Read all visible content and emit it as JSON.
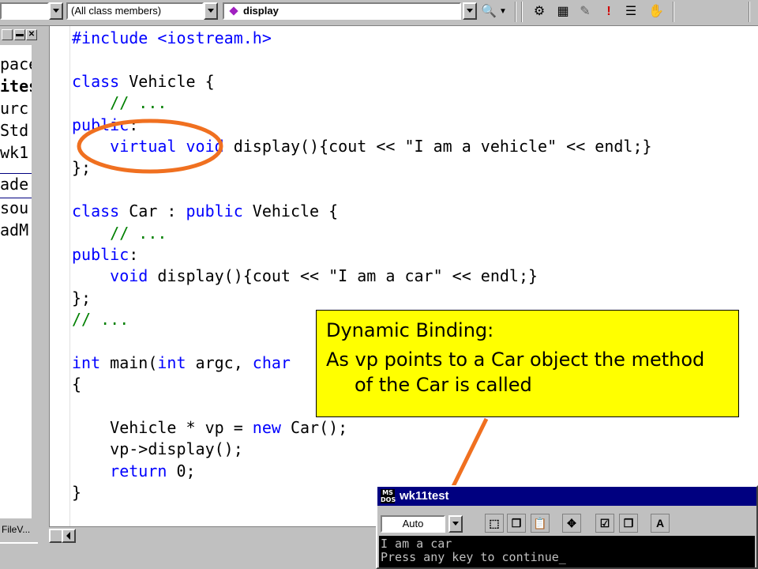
{
  "toolbar": {
    "members_filter": "(All class members)",
    "function_combo": "display",
    "icons": [
      "find-in-files-icon",
      "compile-icon",
      "build-icon",
      "stop-build-icon",
      "execute-icon",
      "output-icon",
      "hand-icon"
    ]
  },
  "workspace": {
    "items": [
      {
        "text": "pace",
        "bold": false
      },
      {
        "text": "ites",
        "bold": true
      },
      {
        "text": "urc",
        "bold": false
      },
      {
        "text": "Std",
        "bold": false
      },
      {
        "text": "wk1",
        "bold": false
      },
      {
        "text": "ade",
        "bold": false
      },
      {
        "text": "sou",
        "bold": false
      },
      {
        "text": "adM",
        "bold": false
      }
    ],
    "tab_label": "FileV..."
  },
  "editor": {
    "lines": [
      [
        {
          "t": "#include <iostream.h>",
          "c": "kw"
        }
      ],
      [
        {
          "t": "",
          "c": ""
        }
      ],
      [
        {
          "t": "class",
          "c": "kw"
        },
        {
          "t": " Vehicle {",
          "c": ""
        }
      ],
      [
        {
          "t": "    // ...",
          "c": "cm"
        }
      ],
      [
        {
          "t": "public",
          "c": "kw"
        },
        {
          "t": ":",
          "c": ""
        }
      ],
      [
        {
          "t": "    ",
          "c": ""
        },
        {
          "t": "virtual",
          "c": "kw"
        },
        {
          "t": " ",
          "c": ""
        },
        {
          "t": "void",
          "c": "kw"
        },
        {
          "t": " display(){cout << \"I am a vehicle\" << endl;}",
          "c": ""
        }
      ],
      [
        {
          "t": "};",
          "c": ""
        }
      ],
      [
        {
          "t": "",
          "c": ""
        }
      ],
      [
        {
          "t": "class",
          "c": "kw"
        },
        {
          "t": " Car : ",
          "c": ""
        },
        {
          "t": "public",
          "c": "kw"
        },
        {
          "t": " Vehicle {",
          "c": ""
        }
      ],
      [
        {
          "t": "    // ...",
          "c": "cm"
        }
      ],
      [
        {
          "t": "public",
          "c": "kw"
        },
        {
          "t": ":",
          "c": ""
        }
      ],
      [
        {
          "t": "    ",
          "c": ""
        },
        {
          "t": "void",
          "c": "kw"
        },
        {
          "t": " display(){cout << \"I am a car\" << endl;}",
          "c": ""
        }
      ],
      [
        {
          "t": "};",
          "c": ""
        }
      ],
      [
        {
          "t": "// ...",
          "c": "cm"
        }
      ],
      [
        {
          "t": "",
          "c": ""
        }
      ],
      [
        {
          "t": "int",
          "c": "kw"
        },
        {
          "t": " main(",
          "c": ""
        },
        {
          "t": "int",
          "c": "kw"
        },
        {
          "t": " argc, ",
          "c": ""
        },
        {
          "t": "char",
          "c": "kw"
        }
      ],
      [
        {
          "t": "{",
          "c": ""
        }
      ],
      [
        {
          "t": "",
          "c": ""
        }
      ],
      [
        {
          "t": "    Vehicle * vp = ",
          "c": ""
        },
        {
          "t": "new",
          "c": "kw"
        },
        {
          "t": " Car();",
          "c": ""
        }
      ],
      [
        {
          "t": "    vp->display();",
          "c": ""
        }
      ],
      [
        {
          "t": "    ",
          "c": ""
        },
        {
          "t": "return",
          "c": "kw"
        },
        {
          "t": " 0;",
          "c": ""
        }
      ],
      [
        {
          "t": "}",
          "c": ""
        }
      ]
    ]
  },
  "callout": {
    "line1": "Dynamic Binding:",
    "line2": "As vp points to a Car object  the method of the Car is called"
  },
  "console": {
    "title": "wk11test",
    "font_size_option": "Auto",
    "output_line1": "I am a car",
    "output_line2": "Press any key to continue_"
  },
  "colors": {
    "keyword": "#0000ff",
    "comment": "#008000",
    "callout_bg": "#ffff00",
    "annotation": "#f07020",
    "console_title_bg": "#000080"
  }
}
